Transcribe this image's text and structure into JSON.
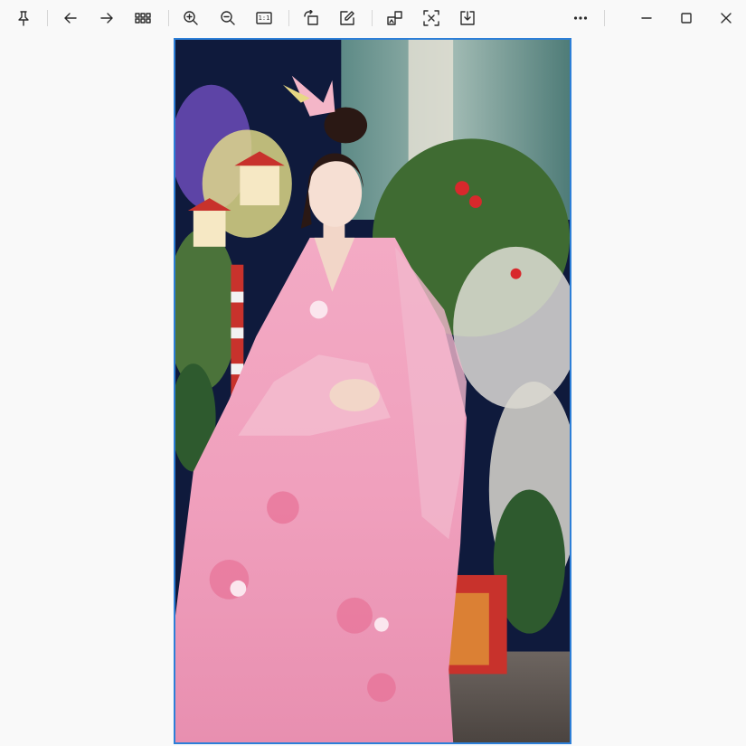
{
  "toolbar": {
    "buttons": [
      {
        "name": "pin-icon"
      },
      {
        "name": "arrow-left-icon"
      },
      {
        "name": "arrow-right-icon"
      },
      {
        "name": "grid-icon"
      },
      {
        "name": "zoom-in-icon"
      },
      {
        "name": "zoom-out-icon"
      },
      {
        "name": "actual-size-icon"
      },
      {
        "name": "rotate-icon"
      },
      {
        "name": "edit-icon"
      },
      {
        "name": "visual-search-icon"
      },
      {
        "name": "text-extract-icon"
      },
      {
        "name": "save-icon"
      },
      {
        "name": "more-icon"
      },
      {
        "name": "minimize-icon"
      },
      {
        "name": "maximize-icon"
      },
      {
        "name": "close-icon"
      }
    ],
    "actual_size_label": "1:1"
  },
  "colors": {
    "accent": "#2d7fd8",
    "background": "#f9f9f9",
    "icon": "#2b2b2b"
  }
}
